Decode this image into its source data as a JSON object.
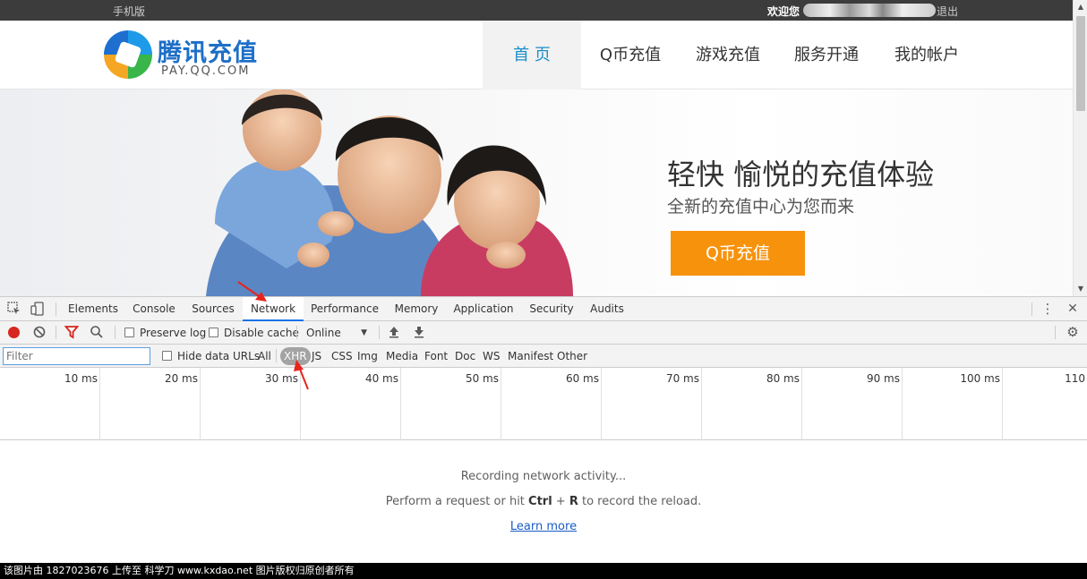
{
  "topbar": {
    "mobile_link": "手机版",
    "welcome": "欢迎您",
    "logout": "退出"
  },
  "header": {
    "logo_cn": "腾讯充值",
    "logo_en": "PAY.QQ.COM",
    "nav": [
      {
        "label": "首 页",
        "active": true
      },
      {
        "label": "Q币充值",
        "active": false
      },
      {
        "label": "游戏充值",
        "active": false
      },
      {
        "label": "服务开通",
        "active": false
      },
      {
        "label": "我的帐户",
        "active": false
      }
    ]
  },
  "banner": {
    "slogan": "轻快 愉悦的充值体验",
    "subslogan": "全新的充值中心为您而来",
    "button": "Q币充值"
  },
  "devtools": {
    "tabs": [
      "Elements",
      "Console",
      "Sources",
      "Network",
      "Performance",
      "Memory",
      "Application",
      "Security",
      "Audits"
    ],
    "active_tab": "Network",
    "toolbar": {
      "preserve_log": "Preserve log",
      "disable_cache": "Disable cache",
      "throttling": "Online"
    },
    "filter": {
      "placeholder": "Filter",
      "hide_data_urls": "Hide data URLs",
      "types": [
        "All",
        "XHR",
        "JS",
        "CSS",
        "Img",
        "Media",
        "Font",
        "Doc",
        "WS",
        "Manifest",
        "Other"
      ],
      "selected_type": "XHR"
    },
    "timeline_ticks": [
      "10 ms",
      "20 ms",
      "30 ms",
      "40 ms",
      "50 ms",
      "60 ms",
      "70 ms",
      "80 ms",
      "90 ms",
      "100 ms",
      "110"
    ],
    "empty": {
      "recording": "Recording network activity...",
      "hint_prefix": "Perform a request or hit ",
      "hint_key1": "Ctrl",
      "hint_plus": " + ",
      "hint_key2": "R",
      "hint_suffix": " to record the reload.",
      "learn_more": "Learn more"
    }
  },
  "watermark": "该图片由 1827023676 上传至 科学刀 www.kxdao.net 图片版权归原创者所有",
  "colors": {
    "accent_nav": "#1a8fc9",
    "button_orange": "#f7920c",
    "devtools_active": "#1a73e8",
    "record_red": "#d7261f",
    "annotation_red": "#e8241c"
  }
}
